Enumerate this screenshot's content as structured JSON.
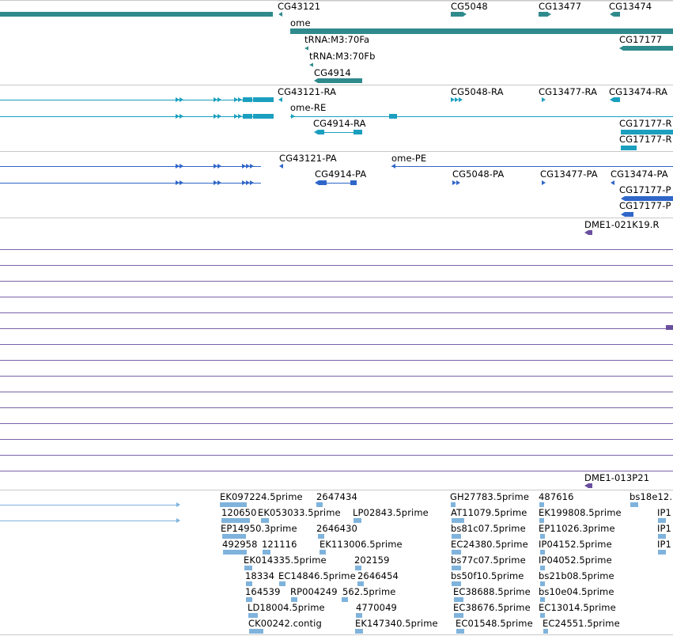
{
  "colors": {
    "gene": "#2f8a8c",
    "transcript_rna": "#1b9fbf",
    "protein": "#2f66c9",
    "clone": "#6a4fa0",
    "clone_line": "#7a62a8",
    "est": "#7fb3dc",
    "separator": "#c8c8c8"
  },
  "tracks": {
    "genes": {
      "labels": [
        "CG43121",
        "CG5048",
        "CG13477",
        "CG13474",
        "ome",
        "CG17177",
        "tRNA:M3:70Fa",
        "tRNA:M3:70Fb",
        "CG4914"
      ]
    },
    "transcripts": {
      "labels": [
        "CG43121-RA",
        "CG5048-RA",
        "CG13477-RA",
        "CG13474-RA",
        "ome-RE",
        "CG4914-RA",
        "CG17177-R",
        "CG17177-R"
      ]
    },
    "proteins": {
      "labels": [
        "CG43121-PA",
        "ome-PE",
        "CG4914-PA",
        "CG5048-PA",
        "CG13477-PA",
        "CG13474-PA",
        "CG17177-P",
        "CG17177-P"
      ]
    },
    "clones": {
      "labels": [
        "DME1-021K19.R",
        "DME1-013P21"
      ]
    },
    "ests": {
      "labels": [
        "EK097224.5prime",
        "2647434",
        "GH27783.5prime",
        "487616",
        "bs18e12.",
        "120650",
        "EK053033.5prime",
        "LP02843.5prime",
        "AT11079.5prime",
        "EK199808.5prime",
        "IP1",
        "EP14950.3prime",
        "2646430",
        "bs81c07.5prime",
        "EP11026.3prime",
        "IP1",
        "492958",
        "121116",
        "EK113006.5prime",
        "EC24380.5prime",
        "IP04152.5prime",
        "IP1",
        "EK014335.5prime",
        "202159",
        "bs77c07.5prime",
        "IP04052.5prime",
        "18334",
        "EC14846.5prime",
        "2646454",
        "bs50f10.5prime",
        "bs21b08.5prime",
        "164539",
        "RP004249",
        "562.5prime",
        "EC38688.5prime",
        "bs10e04.5prime",
        "LD18004.5prime",
        "4770049",
        "EC38676.5prime",
        "EC13014.5prime",
        "CK00242.contig",
        "EK147340.5prime",
        "EC01548.5prime",
        "EC24551.5prime"
      ]
    }
  }
}
